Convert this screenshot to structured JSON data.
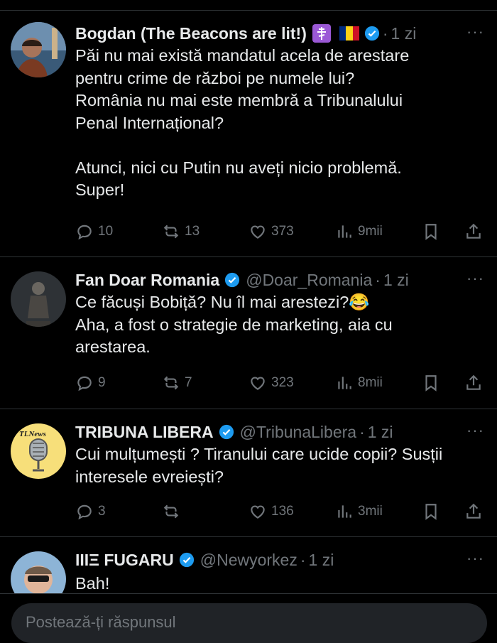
{
  "tweets": [
    {
      "name": "Bogdan (The Beacons are lit!)",
      "handle": "",
      "time": "1 zi",
      "text": "Păi nu mai există mandatul acela de arestare\npentru crime de război pe numele lui?\nRomânia nu mai este membră a Tribunalului\nPenal Internațional?\n\nAtunci, nici cu Putin nu aveți nicio problemă.\nSuper!",
      "replies": "10",
      "reposts": "13",
      "likes": "373",
      "views": "9mii"
    },
    {
      "name": "Fan Doar Romania",
      "handle": "@Doar_Romania",
      "time": "1 zi",
      "text": "Ce făcuși Bobiță? Nu îl mai arestezi?😂\nAha, a fost o strategie de marketing, aia cu\narestarea.",
      "replies": "9",
      "reposts": "7",
      "likes": "323",
      "views": "8mii"
    },
    {
      "name": "TRIBUNA LIBERA",
      "handle": "@TribunaLibera",
      "time": "1 zi",
      "text": "Cui mulțumești ? Tiranului care ucide copii? Susții\ninteresele evreiești?",
      "replies": "3",
      "reposts": "",
      "likes": "136",
      "views": "3mii"
    },
    {
      "name": "IIIΞ FUGARU",
      "handle": "@Newyorkez",
      "time": "1 zi",
      "text": "Bah!"
    }
  ],
  "avatar_logo_text": "TLNews",
  "more_glyph": "···",
  "dot": "·",
  "reply_placeholder": "Postează-ți răspunsul",
  "colors": {
    "verified": "#1d9bf0",
    "muted": "#71767b",
    "text": "#e7e9ea",
    "background": "#000000"
  },
  "icons": [
    "reply-icon",
    "repost-icon",
    "like-icon",
    "views-icon",
    "bookmark-icon",
    "share-icon",
    "verified-badge-icon",
    "orthodox-cross-icon",
    "romania-flag-icon"
  ]
}
